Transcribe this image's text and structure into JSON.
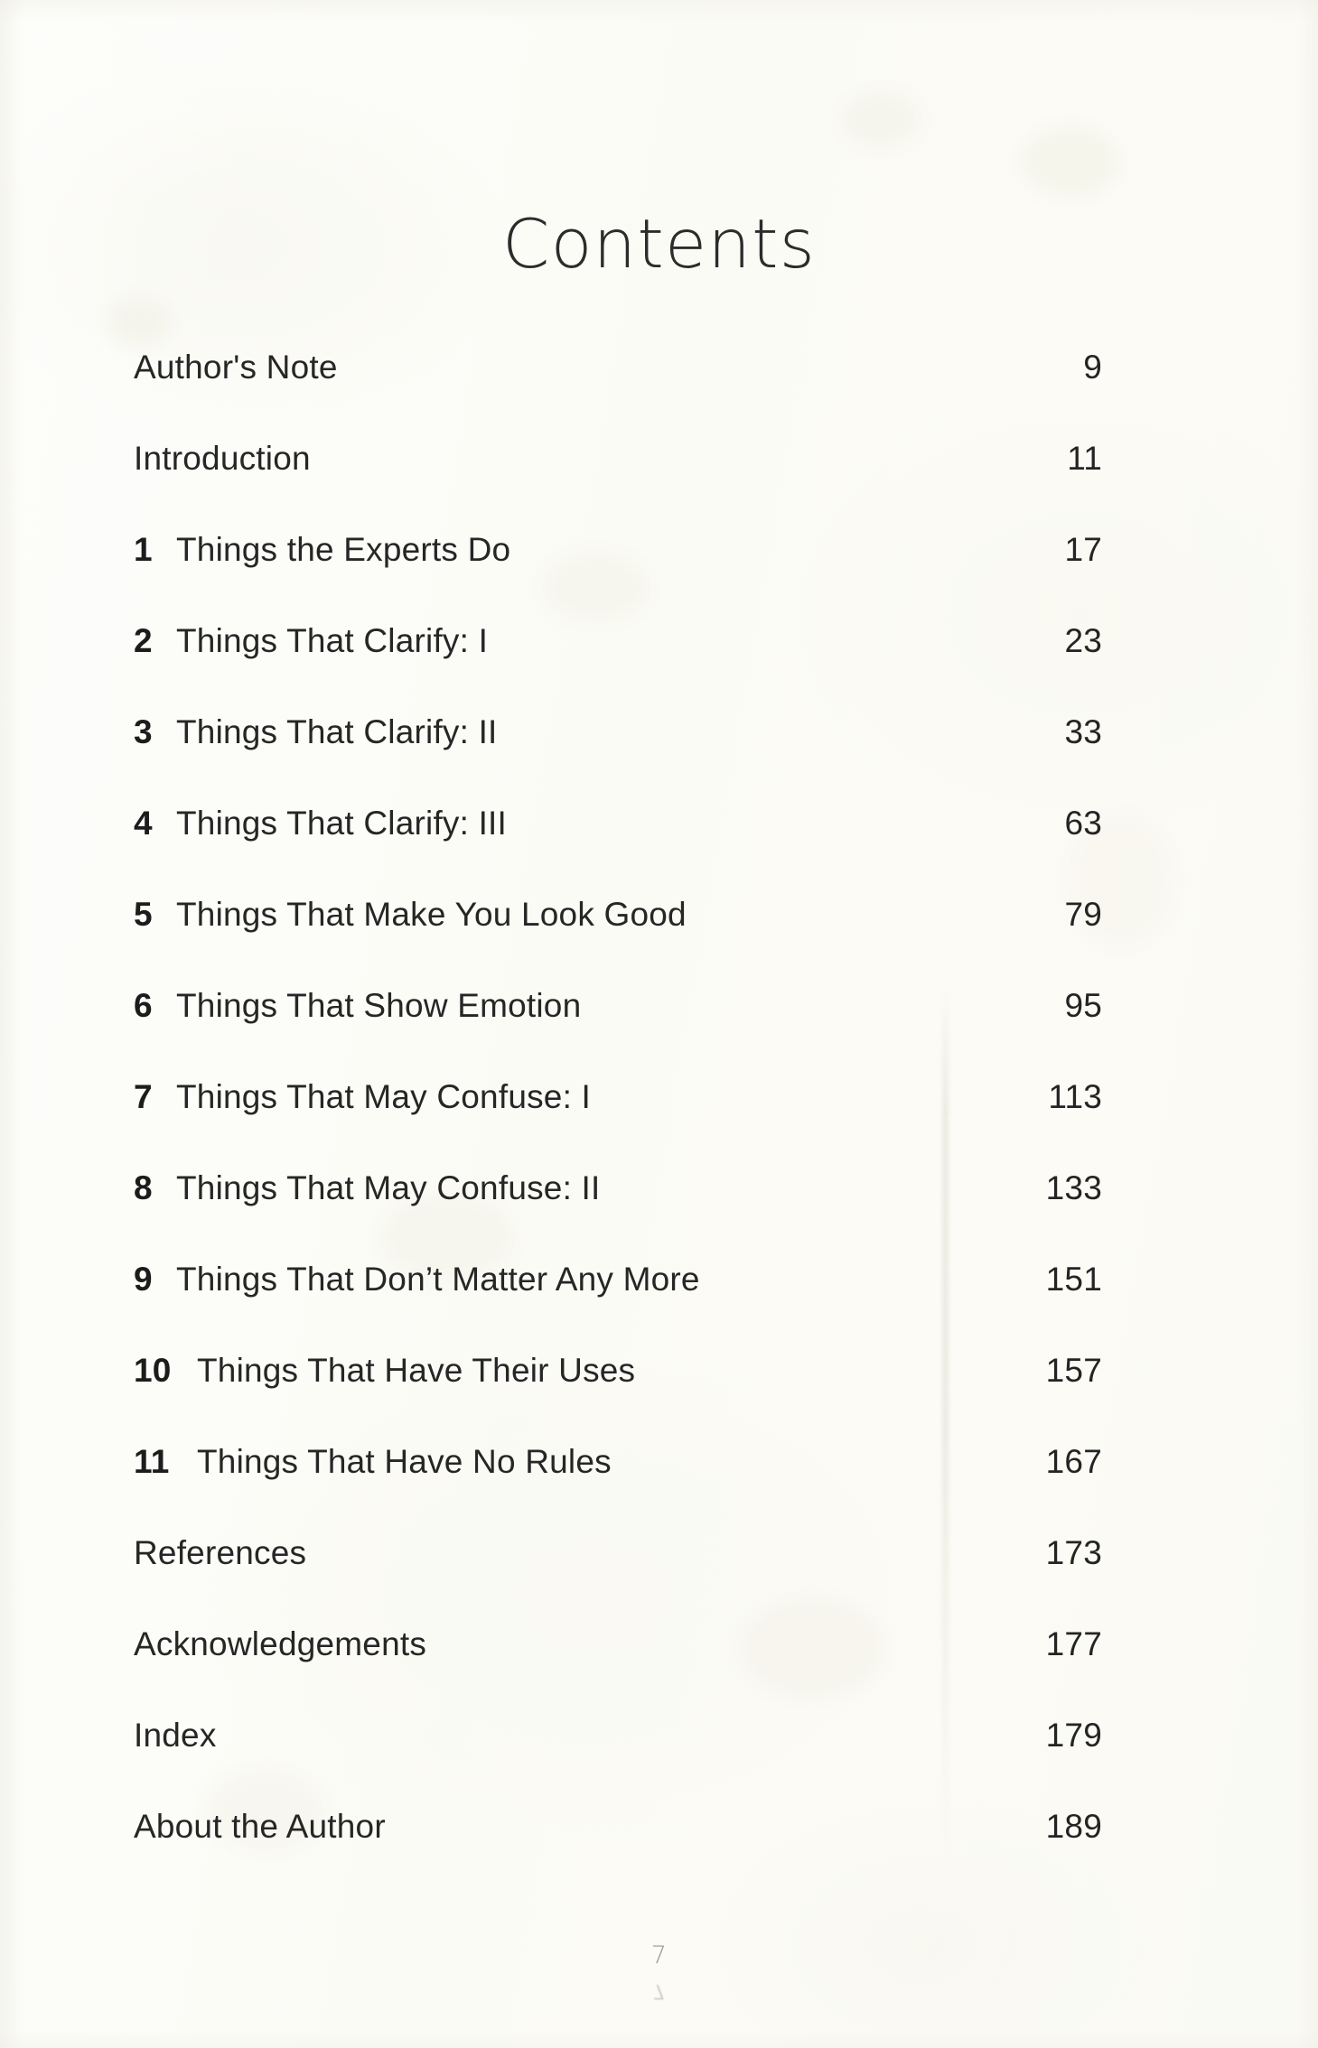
{
  "page": {
    "title": "Contents",
    "folio": "7",
    "folio_showthrough": "7",
    "paper_color": "#fbfbf7",
    "ink_color": "#262626",
    "folio_color": "#9a998f"
  },
  "contents": {
    "entries": [
      {
        "number": "",
        "label": "Author's Note",
        "page": "9"
      },
      {
        "number": "",
        "label": "Introduction",
        "page": "11"
      },
      {
        "number": "1",
        "label": "Things the Experts Do",
        "page": "17"
      },
      {
        "number": "2",
        "label": "Things That Clarify: I",
        "page": "23"
      },
      {
        "number": "3",
        "label": "Things That Clarify: II",
        "page": "33"
      },
      {
        "number": "4",
        "label": "Things That Clarify: III",
        "page": "63"
      },
      {
        "number": "5",
        "label": "Things That Make You Look Good",
        "page": "79"
      },
      {
        "number": "6",
        "label": "Things That Show Emotion",
        "page": "95"
      },
      {
        "number": "7",
        "label": "Things That May Confuse: I",
        "page": "113"
      },
      {
        "number": "8",
        "label": "Things That May Confuse: II",
        "page": "133"
      },
      {
        "number": "9",
        "label": "Things That Don’t Matter Any More",
        "page": "151"
      },
      {
        "number": "10",
        "label": "Things That Have Their Uses",
        "page": "157"
      },
      {
        "number": "11",
        "label": "Things That Have No Rules",
        "page": "167"
      },
      {
        "number": "",
        "label": "References",
        "page": "173"
      },
      {
        "number": "",
        "label": "Acknowledgements",
        "page": "177"
      },
      {
        "number": "",
        "label": "Index",
        "page": "179"
      },
      {
        "number": "",
        "label": "About the Author",
        "page": "189"
      }
    ]
  }
}
